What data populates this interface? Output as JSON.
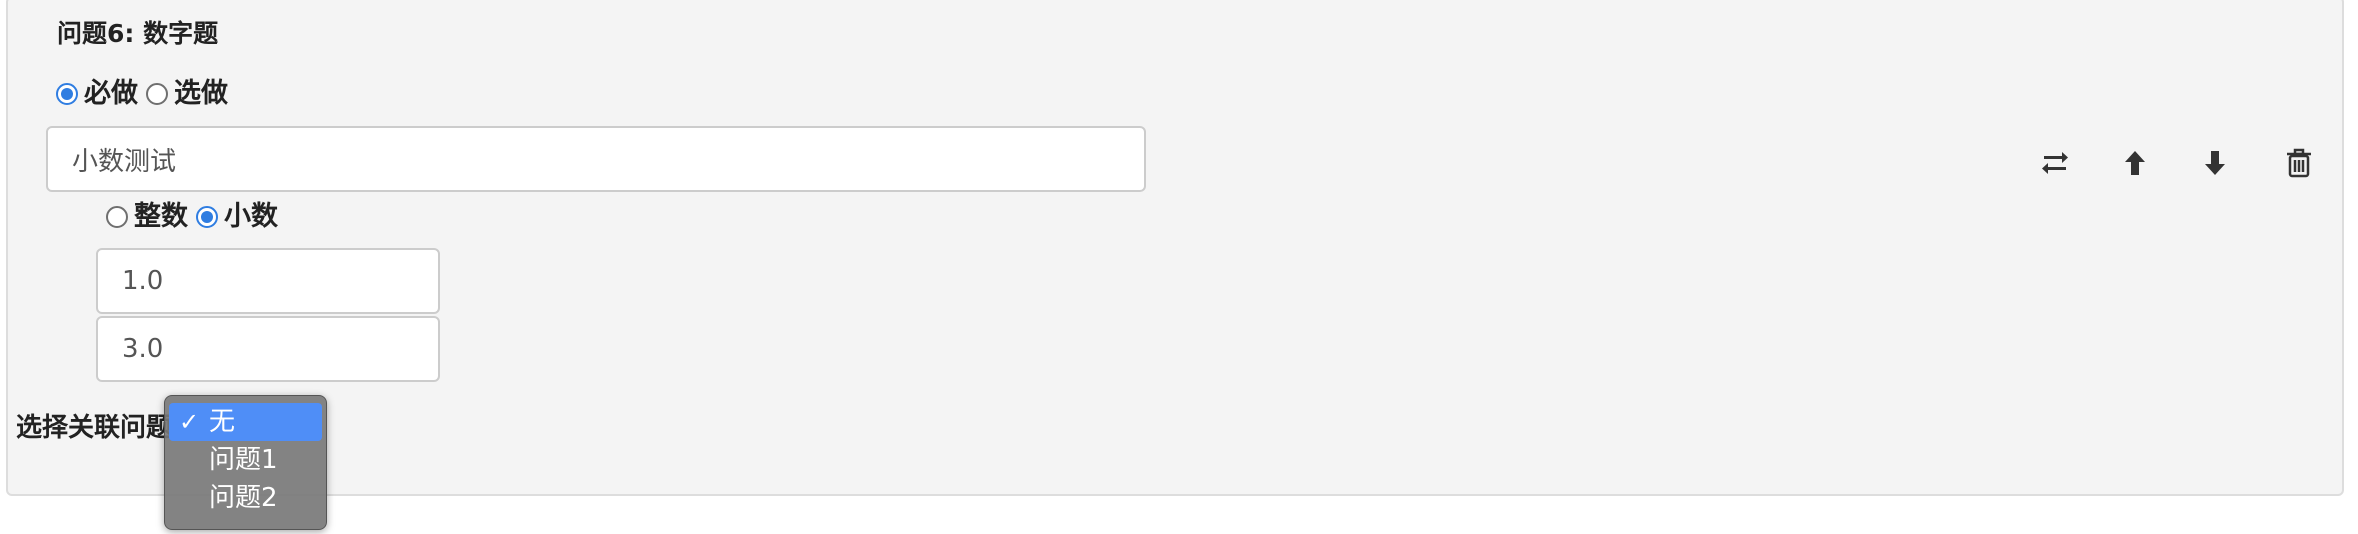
{
  "question": {
    "title": "问题6: 数字题",
    "required_label": "必做",
    "optional_label": "选做",
    "required_selected": true,
    "name_value": "小数测试"
  },
  "number_type": {
    "integer_label": "整数",
    "decimal_label": "小数",
    "decimal_selected": true,
    "min_value": "1.0",
    "max_value": "3.0"
  },
  "association": {
    "label": "选择关联问题",
    "dropdown": {
      "check_mark": "✓",
      "options": [
        "无",
        "问题1",
        "问题2"
      ],
      "selected_index": 0
    }
  },
  "toolbar": {
    "icons": [
      "swap-icon",
      "arrow-up-icon",
      "arrow-down-icon",
      "trash-icon"
    ]
  },
  "colors": {
    "accent": "#2f7de1",
    "panel_bg": "#f4f4f4",
    "dropdown_highlight": "#4f8ef7"
  }
}
